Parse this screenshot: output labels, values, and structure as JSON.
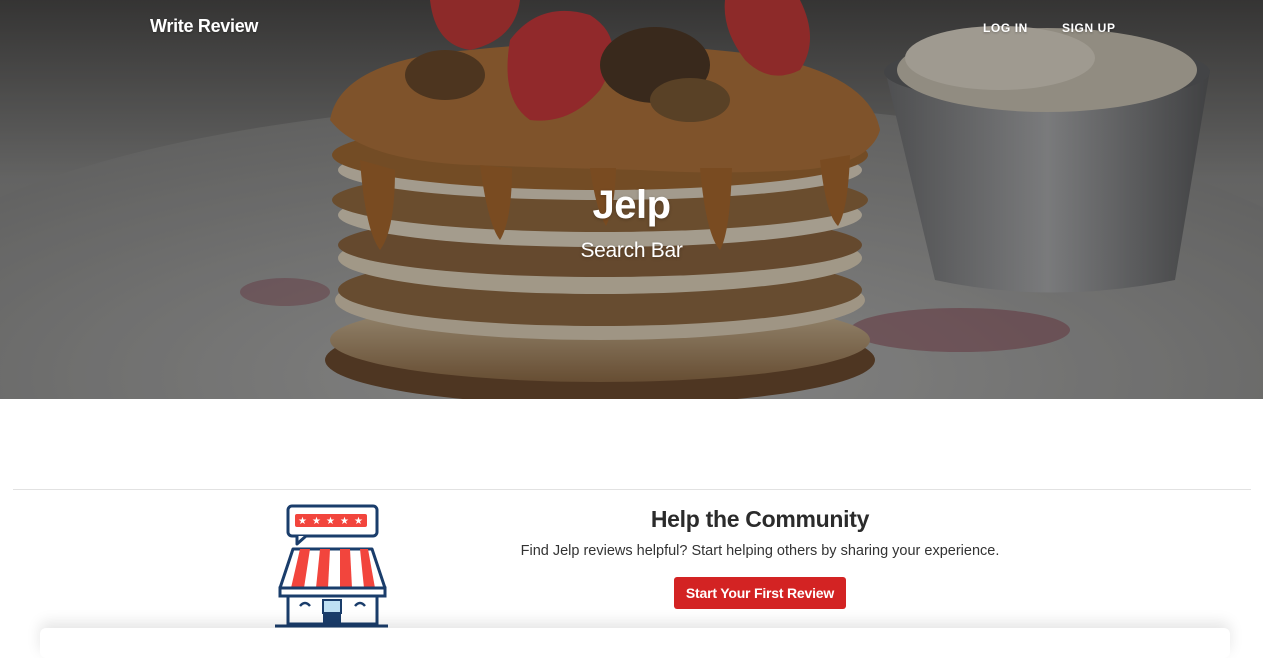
{
  "nav": {
    "write_review": "Write Review",
    "log_in": "LOG IN",
    "sign_up": "SIGN UP"
  },
  "hero": {
    "title": "Jelp",
    "subtitle": "Search Bar"
  },
  "community": {
    "title": "Help the Community",
    "description": "Find Jelp reviews helpful? Start helping others by sharing your experience.",
    "cta_label": "Start Your First Review"
  },
  "colors": {
    "brand_red": "#d32323",
    "text_dark": "#2b2b2b",
    "illustration_navy": "#1a3d6b",
    "illustration_red": "#f2453d"
  },
  "icons": {
    "hero_image": "pancake-stack-photo",
    "store_illustration": "storefront-review-icon"
  }
}
